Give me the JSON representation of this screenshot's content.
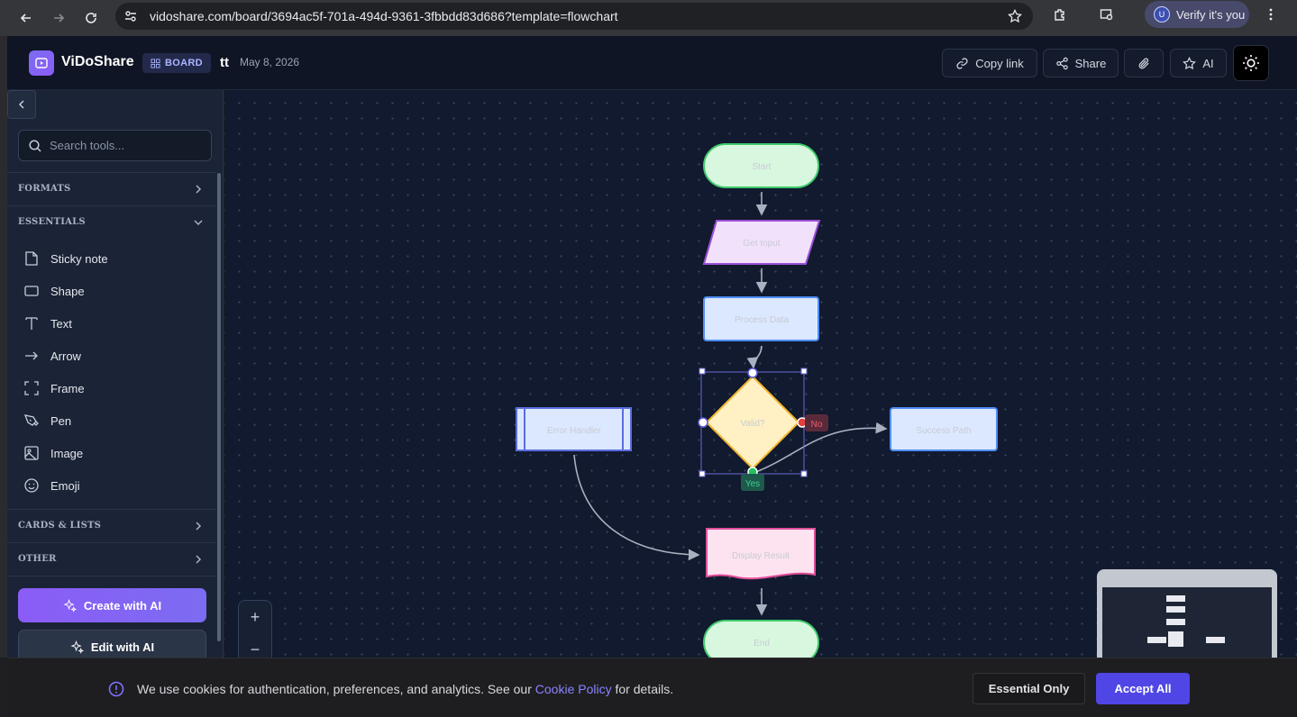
{
  "browser": {
    "url": "vidoshare.com/board/3694ac5f-701a-494d-9361-3fbbdd83d686?template=flowchart",
    "profile_initial": "U",
    "profile_label": "Verify it's you"
  },
  "header": {
    "brand": "ViDoShare",
    "badge": "BOARD",
    "board_name": "tt",
    "date": "May 8, 2026",
    "copy_link": "Copy link",
    "share": "Share",
    "ai": "AI"
  },
  "sidebar": {
    "search_placeholder": "Search tools...",
    "sections": {
      "formats": "FORMATS",
      "essentials": "ESSENTIALS",
      "cards": "CARDS & LISTS",
      "other": "OTHER"
    },
    "tools": [
      "Sticky note",
      "Shape",
      "Text",
      "Arrow",
      "Frame",
      "Pen",
      "Image",
      "Emoji"
    ],
    "create_ai": "Create with AI",
    "edit_ai": "Edit with AI"
  },
  "flowchart": {
    "nodes": {
      "start": "Start",
      "input": "Get Input",
      "process": "Process Data",
      "decision": "Valid?",
      "error": "Error Handler",
      "success": "Success Path",
      "display": "Display Result",
      "end": "End"
    },
    "labels": {
      "no": "No",
      "yes": "Yes"
    }
  },
  "zoom": {
    "in": "+",
    "out": "−"
  },
  "cookie": {
    "text_before": "We use cookies for authentication, preferences, and analytics. See our ",
    "link": "Cookie Policy",
    "text_after": " for details.",
    "essential": "Essential Only",
    "accept": "Accept All"
  },
  "colors": {
    "accent": "#4f46e5",
    "brand_gradient_start": "#8b5cf6",
    "canvas_bg": "#111a2e"
  }
}
